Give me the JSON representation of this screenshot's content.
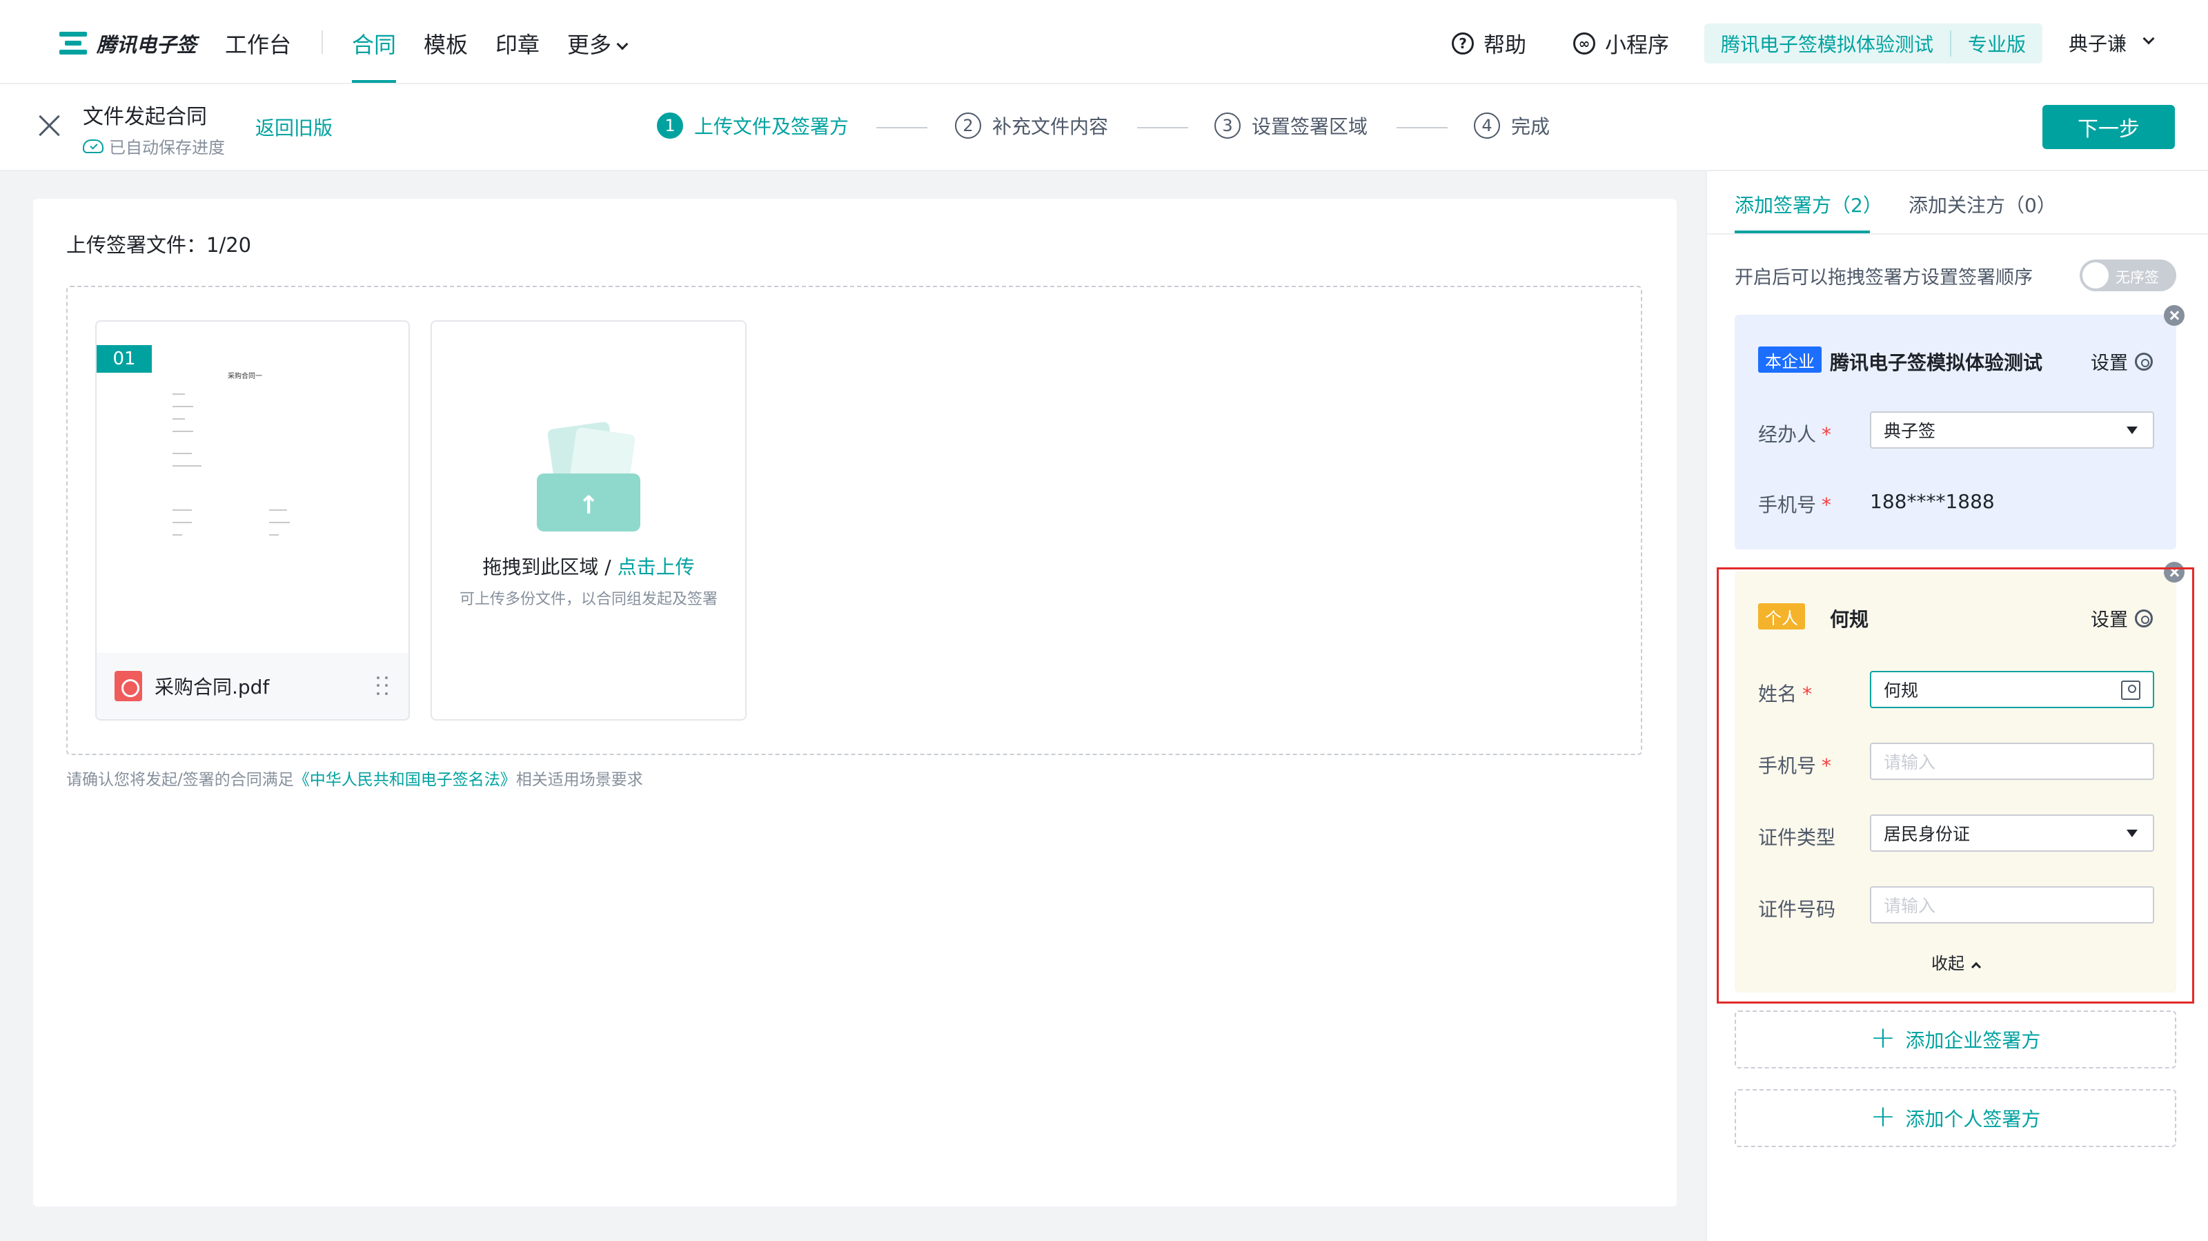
{
  "brand": {
    "name": "腾讯电子签"
  },
  "nav": {
    "workbench": "工作台",
    "contract": "合同",
    "template": "模板",
    "seal": "印章",
    "more": "更多",
    "help": "帮助",
    "mini_program": "小程序",
    "org_name": "腾讯电子签模拟体验测试",
    "edition": "专业版",
    "user": "典子谦"
  },
  "subheader": {
    "title": "文件发起合同",
    "autosave": "已自动保存进度",
    "old_version": "返回旧版",
    "steps": [
      {
        "num": "1",
        "label": "上传文件及签署方"
      },
      {
        "num": "2",
        "label": "补充文件内容"
      },
      {
        "num": "3",
        "label": "设置签署区域"
      },
      {
        "num": "4",
        "label": "完成"
      }
    ],
    "next": "下一步"
  },
  "upload": {
    "title": "上传签署文件：1/20",
    "file_index": "01",
    "file_name": "采购合同.pdf",
    "doc_preview_title": "采购合同一",
    "drag_text": "拖拽到此区域",
    "slash": " / ",
    "click_upload": "点击上传",
    "drag_sub": "可上传多份文件，以合同组发起及签署",
    "law_prefix": "请确认您将发起/签署的合同满足",
    "law_link": "《中华人民共和国电子签名法》",
    "law_suffix": "相关适用场景要求"
  },
  "panel": {
    "tab_signers": "添加签署方（2）",
    "tab_watchers": "添加关注方（0）",
    "order_text": "开启后可以拖拽签署方设置签署顺序",
    "order_toggle": "无序签",
    "corp": {
      "tag": "本企业",
      "name": "腾讯电子签模拟体验测试",
      "setting": "设置",
      "handler_label": "经办人",
      "handler_value": "典子签",
      "phone_label": "手机号",
      "phone_value": "188****1888"
    },
    "person": {
      "tag": "个人",
      "name": "何规",
      "setting": "设置",
      "name_label": "姓名",
      "name_value": "何规",
      "phone_label": "手机号",
      "phone_placeholder": "请输入",
      "id_type_label": "证件类型",
      "id_type_value": "居民身份证",
      "id_no_label": "证件号码",
      "id_no_placeholder": "请输入",
      "collapse": "收起"
    },
    "add_corp": "添加企业签署方",
    "add_person": "添加个人签署方"
  }
}
